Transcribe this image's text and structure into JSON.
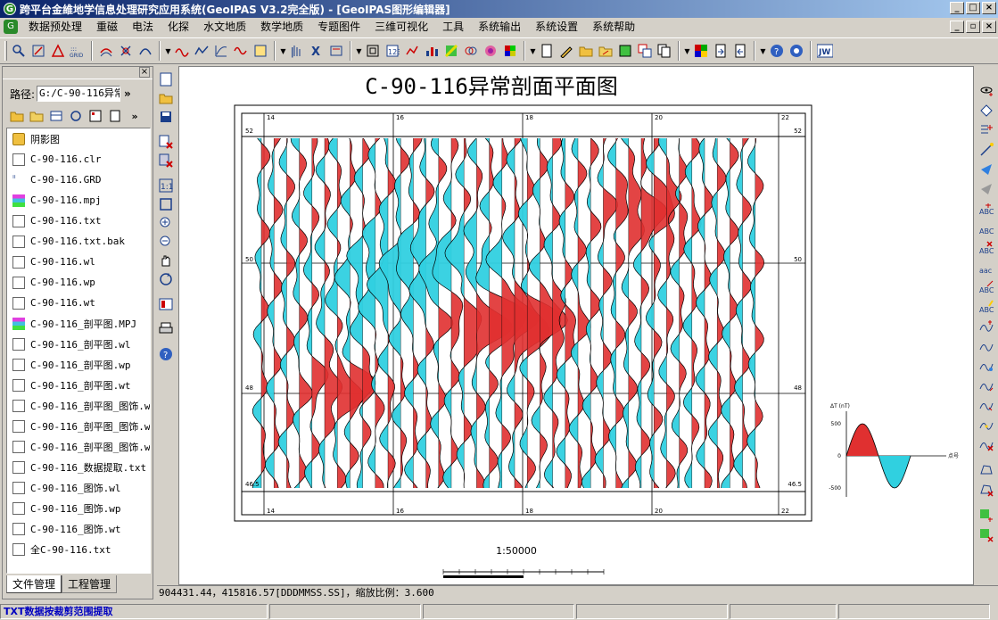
{
  "window": {
    "title": "跨平台金維地学信息处理研究应用系统(GeoIPAS V3.2完全版) - [GeoIPAS图形编辑器]",
    "app_icon": "G",
    "minimize": "_",
    "maximize": "□",
    "close": "×"
  },
  "menu": [
    "数据预处理",
    "重磁",
    "电法",
    "化探",
    "水文地质",
    "数学地质",
    "专题图件",
    "三维可视化",
    "工具",
    "系统输出",
    "系统设置",
    "系统帮助"
  ],
  "mdi": {
    "minimize": "_",
    "restore": "▫",
    "close": "×"
  },
  "left_panel": {
    "close": "×",
    "path_label": "路径:",
    "path_value": "G:/C-90-116异常",
    "more": "»",
    "files": [
      {
        "name": "阴影图",
        "icon": "folder"
      },
      {
        "name": "C-90-116.clr",
        "icon": "doc"
      },
      {
        "name": "C-90-116.GRD",
        "icon": "grid"
      },
      {
        "name": "C-90-116.mpj",
        "icon": "layers"
      },
      {
        "name": "C-90-116.txt",
        "icon": "doc"
      },
      {
        "name": "C-90-116.txt.bak",
        "icon": "doc"
      },
      {
        "name": "C-90-116.wl",
        "icon": "doc"
      },
      {
        "name": "C-90-116.wp",
        "icon": "doc"
      },
      {
        "name": "C-90-116.wt",
        "icon": "doc"
      },
      {
        "name": "C-90-116_剖平图.MPJ",
        "icon": "layers"
      },
      {
        "name": "C-90-116_剖平图.wl",
        "icon": "doc"
      },
      {
        "name": "C-90-116_剖平图.wp",
        "icon": "doc"
      },
      {
        "name": "C-90-116_剖平图.wt",
        "icon": "doc"
      },
      {
        "name": "C-90-116_剖平图_图饰.w",
        "icon": "doc"
      },
      {
        "name": "C-90-116_剖平图_图饰.w",
        "icon": "doc"
      },
      {
        "name": "C-90-116_剖平图_图饰.w",
        "icon": "doc"
      },
      {
        "name": "C-90-116_数据提取.txt",
        "icon": "doc"
      },
      {
        "name": "C-90-116_图饰.wl",
        "icon": "doc"
      },
      {
        "name": "C-90-116_图饰.wp",
        "icon": "doc"
      },
      {
        "name": "C-90-116_图饰.wt",
        "icon": "doc"
      },
      {
        "name": "全C-90-116.txt",
        "icon": "doc"
      }
    ],
    "tabs": [
      "文件管理",
      "工程管理"
    ]
  },
  "map": {
    "title": "C-90-116异常剖面平面图",
    "x_ticks": [
      "14",
      "16",
      "18",
      "20",
      "22"
    ],
    "y_ticks": [
      "52",
      "50",
      "48",
      "46.5"
    ],
    "scale_text": "1:50000",
    "legend": {
      "y_label": "ΔT (nT)",
      "ticks": [
        "500",
        "0",
        "-500"
      ],
      "x_label": "点号"
    },
    "colors": {
      "positive": "#e03030",
      "negative": "#30d0e0"
    }
  },
  "status": {
    "coords": "904431.44，415816.57[DDDMMSS.SS]，缩放比例：3.600",
    "message": "TXT数据按裁剪范围提取"
  }
}
